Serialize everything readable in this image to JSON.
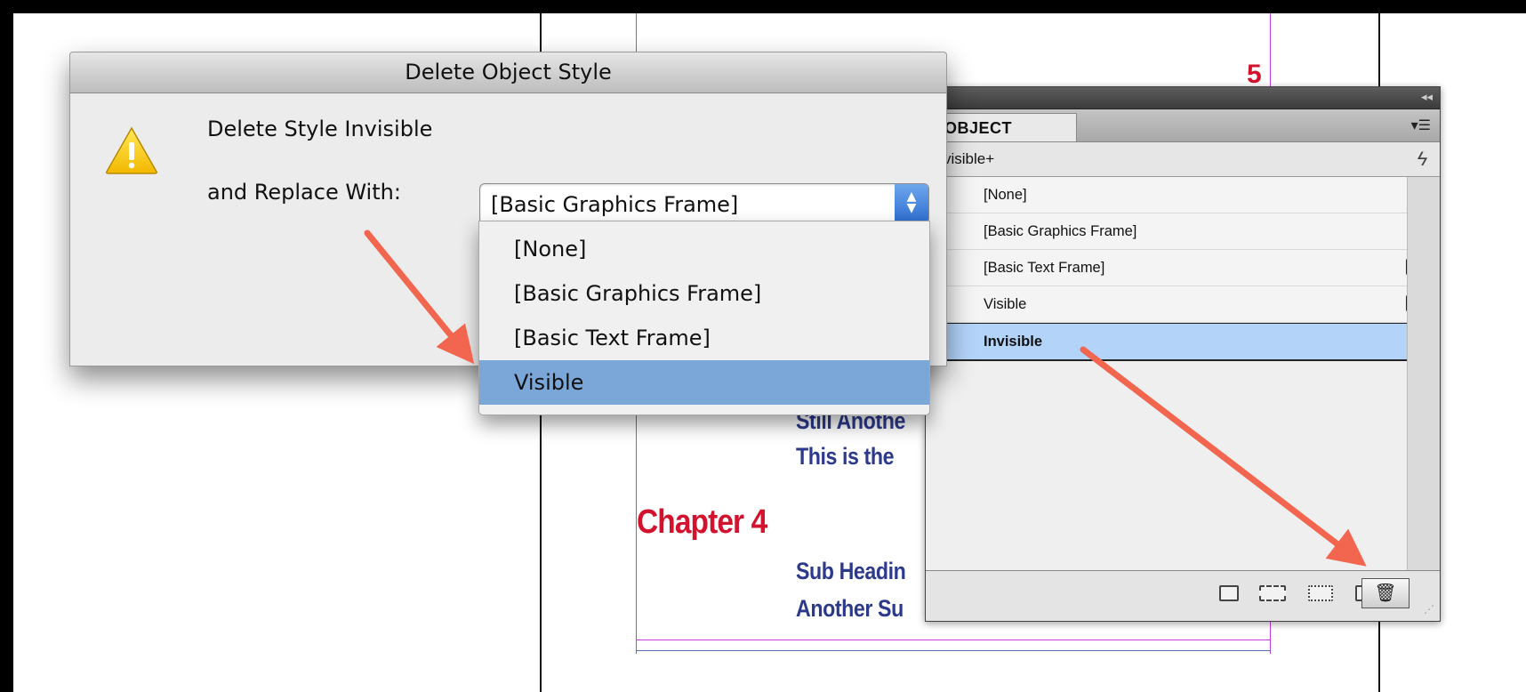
{
  "document": {
    "chapter_heading": "Chapter 4",
    "lines": [
      "Still Anothe",
      "This is the",
      "Sub Headin",
      "Another Su"
    ],
    "top_glyph": "5"
  },
  "dialog": {
    "title": "Delete Object Style",
    "message": "Delete Style Invisible",
    "replace_label": "and Replace With:",
    "selected_value": "[Basic Graphics Frame]",
    "options": [
      "[None]",
      "[Basic Graphics Frame]",
      "[Basic Text Frame]",
      "Visible"
    ],
    "highlighted_option": "Visible",
    "icon": "warning-icon"
  },
  "panel": {
    "tab_label": "OBJECT STYLES",
    "current_style": "visible+",
    "styles": [
      {
        "label": "[None]",
        "icon": "clear-overrides-icon"
      },
      {
        "label": "[Basic Graphics Frame]",
        "icon": ""
      },
      {
        "label": "[Basic Text Frame]",
        "icon": "text-frame-icon"
      },
      {
        "label": "Visible",
        "icon": "graphics-frame-icon"
      },
      {
        "label": "Invisible",
        "icon": ""
      }
    ],
    "selected_style": "Invisible",
    "bottom_tools": [
      "new-group-icon",
      "load-styles-icon",
      "clear-attributes-icon",
      "new-style-icon",
      "delete-style-icon"
    ]
  },
  "colors": {
    "annotation_arrow": "#f2654f",
    "chapter_red": "#d3122e",
    "heading_blue": "#2d3a8c",
    "selection_blue": "#b3d3f9",
    "menu_highlight": "#7ba7d8"
  }
}
